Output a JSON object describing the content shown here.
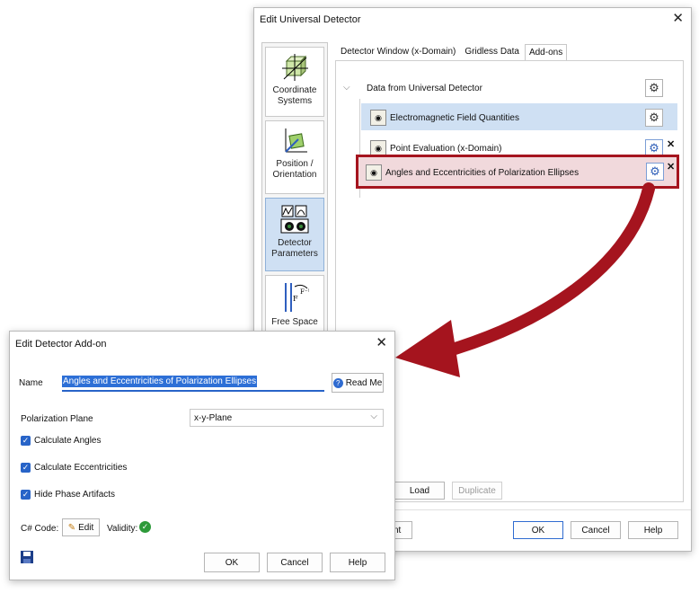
{
  "main_dialog": {
    "title": "Edit Universal Detector",
    "sidebar": [
      {
        "label": "Coordinate Systems",
        "icon": "coordinate-cube-icon"
      },
      {
        "label": "Position / Orientation",
        "icon": "position-axes-icon"
      },
      {
        "label": "Detector Parameters",
        "icon": "detector-parameters-icon"
      },
      {
        "label": "Free Space",
        "icon": "fourier-transform-icon"
      }
    ],
    "tabs": [
      "Detector Window (x-Domain)",
      "Gridless Data",
      "Add-ons"
    ],
    "active_tab": "Add-ons",
    "tree": {
      "root": "Data from Universal Detector",
      "items": [
        "Electromagnetic Field Quantities",
        "Point Evaluation (x-Domain)",
        "Angles and Eccentricities of Polarization Ellipses"
      ]
    },
    "buttons": {
      "load": "Load",
      "duplicate": "Duplicate",
      "partial_left": "nt",
      "ok": "OK",
      "cancel": "Cancel",
      "help": "Help"
    }
  },
  "sub_dialog": {
    "title": "Edit Detector Add-on",
    "name_label": "Name",
    "name_value": "Angles and Eccentricities of Polarization Ellipses",
    "read_me": "Read Me",
    "plane_label": "Polarization Plane",
    "plane_value": "x-y-Plane",
    "checks": [
      "Calculate Angles",
      "Calculate Eccentricities",
      "Hide Phase Artifacts"
    ],
    "code_label": "C# Code:",
    "edit": "Edit",
    "validity": "Validity:",
    "ok": "OK",
    "cancel": "Cancel",
    "help": "Help"
  },
  "colors": {
    "highlight_red": "#a5141e",
    "selection_blue": "#cfe0f3",
    "checkbox_blue": "#2864c8"
  }
}
